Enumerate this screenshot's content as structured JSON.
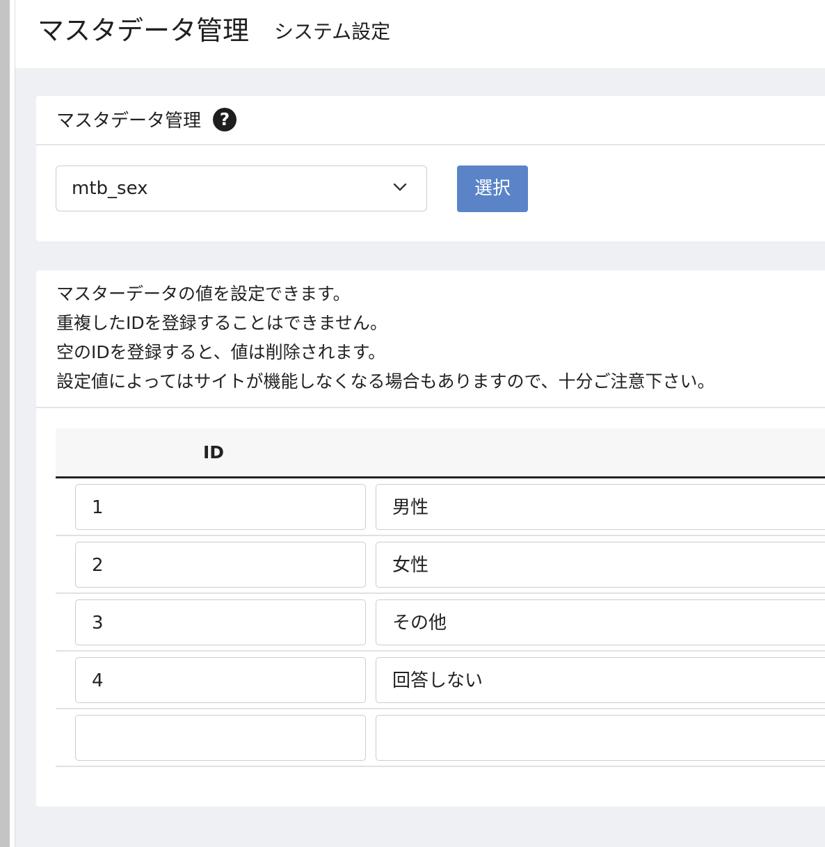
{
  "header": {
    "title": "マスタデータ管理",
    "subtitle": "システム設定"
  },
  "select_card": {
    "title": "マスタデータ管理",
    "help_icon": "question-circle-icon",
    "select_value": "mtb_sex",
    "select_button_label": "選択"
  },
  "table_card": {
    "notice_lines": [
      "マスターデータの値を設定できます。",
      "重複したIDを登録することはできません。",
      "空のIDを登録すると、値は削除されます。",
      "設定値によってはサイトが機能しなくなる場合もありますので、十分ご注意下さい。"
    ],
    "columns": {
      "id": "ID"
    },
    "rows": [
      {
        "id": "1",
        "name": "男性"
      },
      {
        "id": "2",
        "name": "女性"
      },
      {
        "id": "3",
        "name": "その他"
      },
      {
        "id": "4",
        "name": "回答しない"
      },
      {
        "id": "",
        "name": ""
      }
    ]
  },
  "colors": {
    "page_background": "#eef0f4",
    "primary_button": "#5a83c8",
    "table_head_border": "#1f2328"
  }
}
